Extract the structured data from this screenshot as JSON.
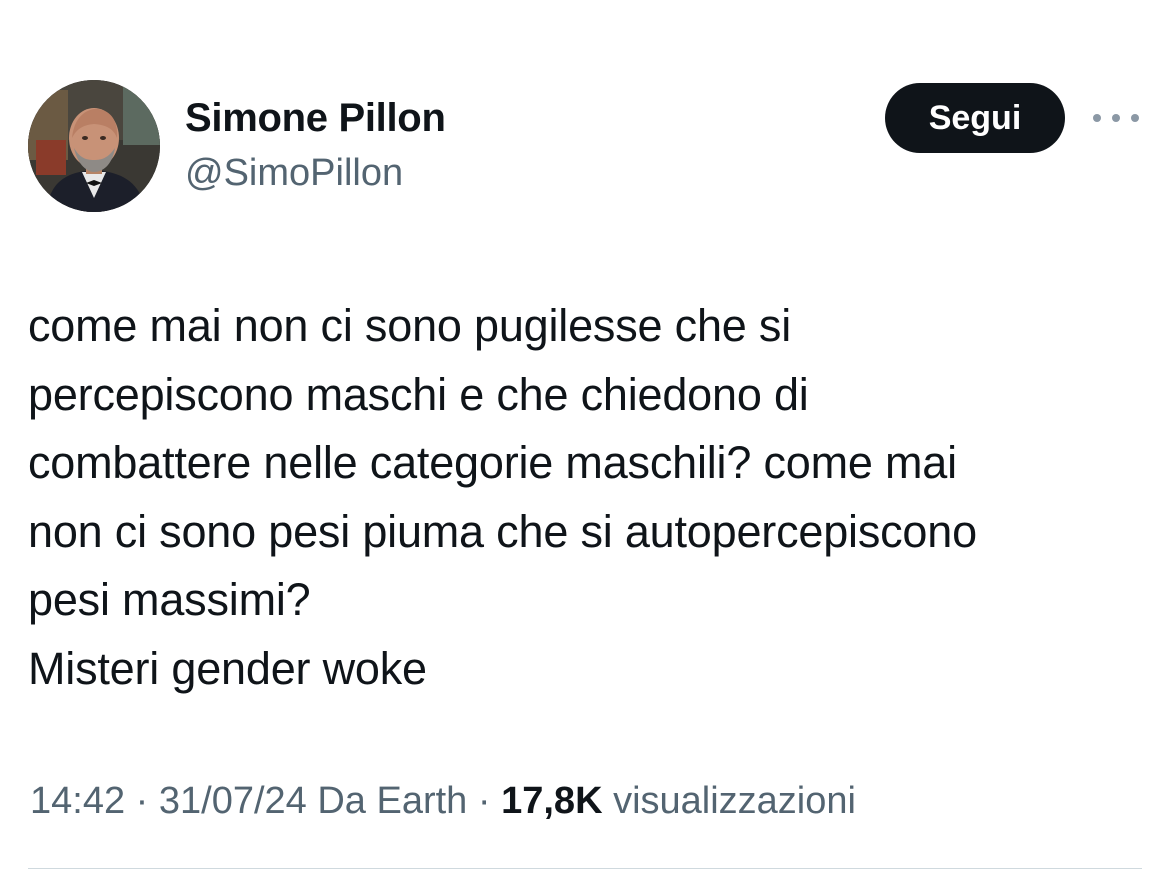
{
  "author": {
    "display_name": "Simone Pillon",
    "handle": "@SimoPillon",
    "avatar_alt": "profile photo"
  },
  "actions": {
    "follow_label": "Segui",
    "more_icon": "more-horizontal-icon"
  },
  "tweet": {
    "lines": [
      "come mai non ci sono pugilesse che si",
      "percepiscono maschi e che chiedono di",
      "combattere nelle categorie maschili? come mai",
      "non ci sono pesi piuma che si autopercepiscono",
      "pesi massimi?",
      "Misteri gender woke"
    ]
  },
  "meta": {
    "time": "14:42",
    "separator": "·",
    "date": "31/07/24",
    "source": "Da Earth",
    "views_count": "17,8K",
    "views_label": "visualizzazioni"
  },
  "colors": {
    "text_primary": "#0f1419",
    "text_secondary": "#536471",
    "button_bg": "#0f1419",
    "divider": "#cfd9de"
  }
}
